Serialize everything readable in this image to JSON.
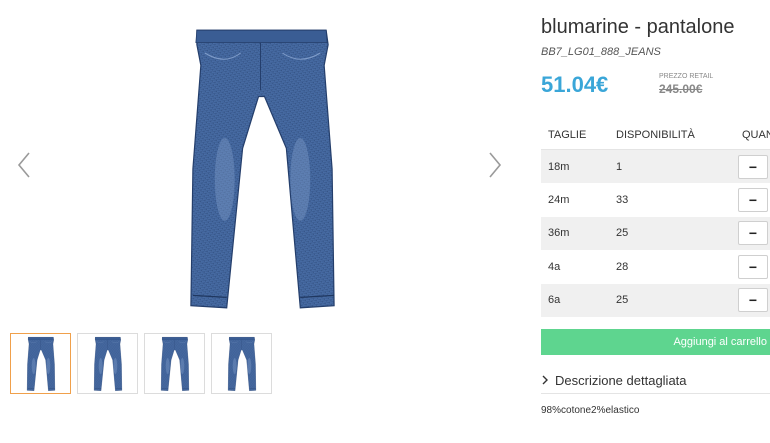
{
  "product": {
    "title": "blumarine - pantalone",
    "sku": "BB7_LG01_888_JEANS",
    "price": "51.04€",
    "retail_label": "PREZZO RETAIL",
    "retail_price": "245.00€"
  },
  "gallery": {
    "prev_icon": "chevron-left-icon",
    "next_icon": "chevron-right-icon",
    "thumbnail_count": 4,
    "active_thumbnail": 1
  },
  "sizes_table": {
    "headers": [
      "TAGLIE",
      "DISPONIBILITÀ",
      "QUANTITÀ"
    ],
    "rows": [
      {
        "size": "18m",
        "availability": "1",
        "qty_icon": "minus-icon"
      },
      {
        "size": "24m",
        "availability": "33",
        "qty_icon": "minus-icon"
      },
      {
        "size": "36m",
        "availability": "25",
        "qty_icon": "minus-icon"
      },
      {
        "size": "4a",
        "availability": "28",
        "qty_icon": "minus-icon"
      },
      {
        "size": "6a",
        "availability": "25",
        "qty_icon": "minus-icon"
      }
    ]
  },
  "cart": {
    "add_label": "Aggiungi al carrello"
  },
  "description": {
    "toggle_label": "Descrizione dettagliata",
    "text": "98%cotone2%elastico"
  },
  "colors": {
    "price": "#3aa6d8",
    "cart_button": "#5ed58f",
    "active_thumb_border": "#f0a04b",
    "denim": "#34558c"
  }
}
